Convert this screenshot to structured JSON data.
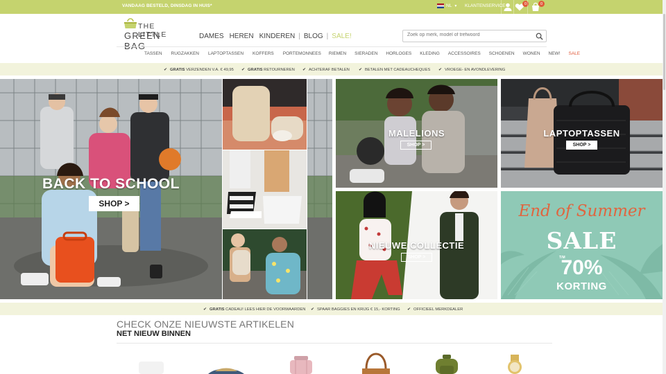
{
  "topbar": {
    "promo": "VANDAAG BESTELD, DINSDAG IN HUIS*",
    "lang": "NL",
    "service": "KLANTENSERVICE",
    "wishlist_count": "0",
    "cart_count": "0"
  },
  "logo": {
    "line1": "THE LITTLE",
    "line2": "GREEN BAG"
  },
  "mainnav": [
    "DAMES",
    "HEREN",
    "KINDEREN",
    "BLOG",
    "SALE!"
  ],
  "search": {
    "placeholder": "Zoek op merk, model of trefwoord"
  },
  "subnav": [
    "TASSEN",
    "RUGZAKKEN",
    "LAPTOPTASSEN",
    "KOFFERS",
    "PORTEMONNEES",
    "RIEMEN",
    "SIERADEN",
    "HORLOGES",
    "KLEDING",
    "ACCESSOIRES",
    "SCHOENEN",
    "WONEN",
    "NEW!",
    "SALE"
  ],
  "usp_top": [
    {
      "bold": "GRATIS",
      "text": " VERZENDEN V.A. € 49,95"
    },
    {
      "bold": "GRATIS",
      "text": " RETOURNEREN"
    },
    {
      "bold": "",
      "text": "ACHTERAF BETALEN"
    },
    {
      "bold": "",
      "text": "BETALEN MET CADEAUCHEQUES"
    },
    {
      "bold": "",
      "text": "VROEGE- EN AVONDLEVERING"
    }
  ],
  "hero": {
    "back_to_school": "BACK TO SCHOOL",
    "shop_main": "SHOP >",
    "malelions": "MALELIONS",
    "shop_malelions": "SHOP >",
    "laptoptassen": "LAPTOPTASSEN",
    "shop_laptop": "SHOP >",
    "nieuwe_collectie": "NIEUWE COLLECTIE",
    "shop_collectie": "SHOP >",
    "end_of_summer": "End of Summer",
    "sale": "SALE",
    "tm": "T/M",
    "pct": "70%",
    "korting": "KORTING"
  },
  "usp_bottom": [
    {
      "bold": "GRATIS",
      "text": " CADEAU! LEES HIER DE VOORWAARDEN"
    },
    {
      "bold": "",
      "text": "SPAAR BAGGIES EN KRIJG € 15,- KORTING"
    },
    {
      "bold": "",
      "text": "OFFICIEEL MERKDEALER"
    }
  ],
  "section": {
    "title": "CHECK ONZE NIEUWSTE ARTIKELEN",
    "subtitle": "NET NIEUW BINNEN"
  },
  "colors": {
    "accent": "#c5d36e",
    "sale": "#e05a3a",
    "usp_bg": "#f2f3dc",
    "summer_bg": "#8fc9b6"
  }
}
